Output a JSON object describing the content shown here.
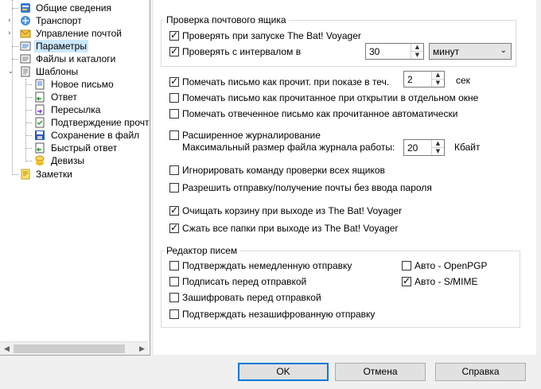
{
  "tree": {
    "items": [
      {
        "label": "Общие сведения",
        "icon": "info-card-icon"
      },
      {
        "label": "Транспорт",
        "icon": "transport-icon"
      },
      {
        "label": "Управление почтой",
        "icon": "mail-management-icon"
      },
      {
        "label": "Параметры",
        "icon": "parameters-icon"
      },
      {
        "label": "Файлы и каталоги",
        "icon": "files-folders-icon"
      },
      {
        "label": "Шаблоны",
        "icon": "templates-icon"
      },
      {
        "label": "Новое письмо",
        "icon": "new-letter-icon"
      },
      {
        "label": "Ответ",
        "icon": "reply-icon"
      },
      {
        "label": "Пересылка",
        "icon": "forward-icon"
      },
      {
        "label": "Подтверждение прочте",
        "icon": "read-confirmation-icon"
      },
      {
        "label": "Сохранение в файл",
        "icon": "save-to-file-icon"
      },
      {
        "label": "Быстрый ответ",
        "icon": "quick-reply-icon"
      },
      {
        "label": "Девизы",
        "icon": "mottos-icon"
      },
      {
        "label": "Заметки",
        "icon": "notes-icon"
      }
    ]
  },
  "check_mailbox": {
    "title": "Проверка почтового ящика",
    "check_on_start": {
      "label": "Проверять при запуске The Bat! Voyager",
      "checked": true
    },
    "check_interval": {
      "label": "Проверять с интервалом в",
      "checked": true,
      "value": "30",
      "unit": "минут"
    }
  },
  "options": {
    "mark_read": {
      "label": "Помечать письмо как прочит. при показе в теч.",
      "checked": true,
      "value": "2",
      "unit": "сек"
    },
    "mark_read_window": {
      "label": "Помечать письмо как прочитанное при открытии в отдельном окне",
      "checked": false
    },
    "mark_replied": {
      "label": "Помечать отвеченное письмо как прочитанное автоматически",
      "checked": false
    },
    "ext_log": {
      "label": "Расширенное журналирование",
      "checked": false,
      "size_label": "Максимальный размер файла журнала работы:",
      "size_value": "20",
      "size_unit": "Кбайт"
    },
    "ignore_check_all": {
      "label": "Игнорировать команду проверки всех ящиков",
      "checked": false
    },
    "allow_no_password": {
      "label": "Разрешить отправку/получение почты без ввода пароля",
      "checked": false
    },
    "clear_trash": {
      "label": "Очищать корзину при выходе из The Bat! Voyager",
      "checked": true
    },
    "compress_folders": {
      "label": "Сжать все папки при выходе из The Bat! Voyager",
      "checked": true
    }
  },
  "editor": {
    "title": "Редактор писем",
    "confirm_send": {
      "label": "Подтверждать немедленную отправку",
      "checked": false
    },
    "sign_before": {
      "label": "Подписать перед отправкой",
      "checked": false
    },
    "encrypt_before": {
      "label": "Зашифровать перед отправкой",
      "checked": false
    },
    "confirm_unencrypted": {
      "label": "Подтверждать незашифрованную отправку",
      "checked": false
    },
    "auto_openpgp": {
      "label": "Авто - OpenPGP",
      "checked": false
    },
    "auto_smime": {
      "label": "Авто - S/MIME",
      "checked": true
    }
  },
  "buttons": {
    "ok": "OK",
    "cancel": "Отмена",
    "help": "Справка"
  }
}
